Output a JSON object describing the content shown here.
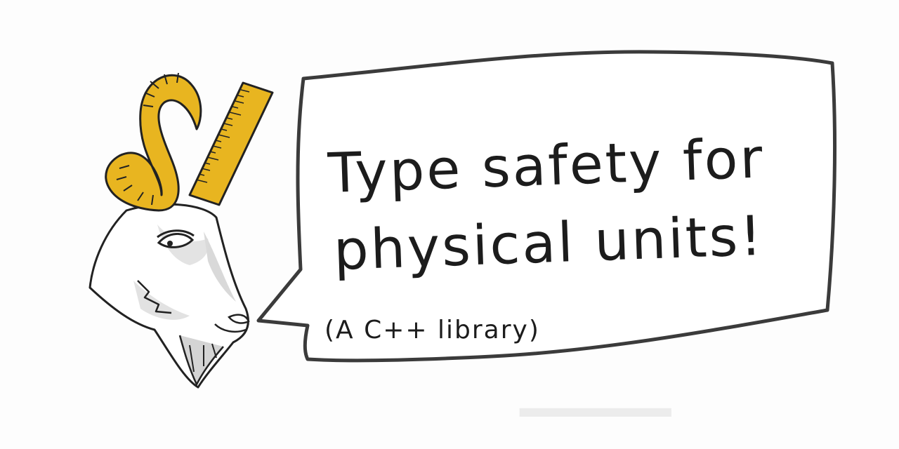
{
  "speech": {
    "line1": "Type safety for",
    "line2": "physical units!",
    "subtitle": "(A C++ library)"
  },
  "icons": {
    "mascot": "goat-head-with-ruler-horn-icon",
    "bubble": "speech-bubble-icon"
  },
  "colors": {
    "horn": "#e8b520",
    "ink": "#1c1c1c",
    "outline": "#3b3b3b",
    "shading": "#cfcfcf"
  }
}
